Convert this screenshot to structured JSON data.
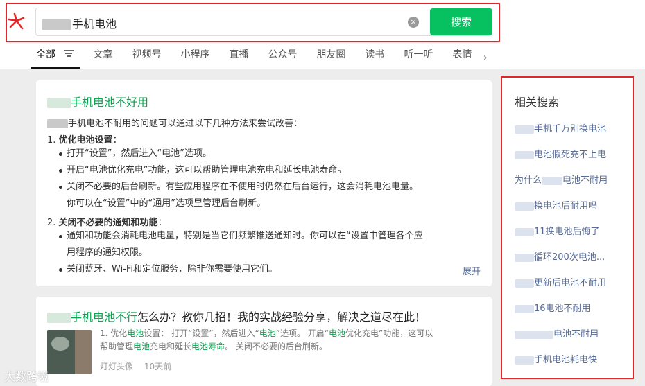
{
  "search": {
    "query_suffix": "手机电池",
    "button_label": "搜索",
    "clear_glyph": "×"
  },
  "tabs": [
    {
      "label": "全部"
    },
    {
      "label": "文章"
    },
    {
      "label": "视频号"
    },
    {
      "label": "小程序"
    },
    {
      "label": "直播"
    },
    {
      "label": "公众号"
    },
    {
      "label": "朋友圈"
    },
    {
      "label": "读书"
    },
    {
      "label": "听一听"
    },
    {
      "label": "表情"
    }
  ],
  "tabs_more_glyph": "›",
  "result1": {
    "title_suffix": "手机电池不好用",
    "intro_suffix": "手机电池不耐用的问题可以通过以下几种方法来尝试改善：",
    "sec1_num": "1.",
    "sec1_head": "优化电池设置",
    "sec1_colon": "：",
    "sec1_b1": "打开“设置”，然后进入“电池”选项。",
    "sec1_b2": "开启“电池优化充电”功能，这可以帮助管理电池充电和延长电池寿命。",
    "sec1_b3a": "关闭不必要的后台刷新。有些应用程序在不使用时仍然在后台运行，这会消耗电池电量。",
    "sec1_b3b": "你可以在“设置”中的“通用”选项里管理后台刷新。",
    "sec2_num": "2.",
    "sec2_head": "关闭不必要的通知和功能",
    "sec2_colon": "：",
    "sec2_b1a": "通知和功能会消耗电池电量，特别是当它们频繁推送通知时。你可以在“设置中管理各个应",
    "sec2_b1b": "用程序的通知权限。",
    "sec2_b2": "关闭蓝牙、Wi-Fi和定位服务，除非你需要使用它们。",
    "expand_label": "展开"
  },
  "result2": {
    "title_em": "手机电池不行",
    "title_rest": "怎么办？教你几招！我的实战经验分享，解决之道尽在此！",
    "snip1": "1. 优化",
    "snip_hl1": "电池",
    "snip2": "设置： 打开“设置”，然后进入“",
    "snip_hl2": "电池",
    "snip3": "”选项。 开启“",
    "snip_hl3": "电池",
    "snip4": "优化充电”功能，这可以",
    "snip5": "帮助管理",
    "snip_hl4": "电池",
    "snip6": "充电和延长",
    "snip_hl5": "电池寿命",
    "snip7": "。 关闭不必要的后台刷新。",
    "author": "灯灯头像",
    "time": "10天前"
  },
  "related": {
    "title": "相关搜索",
    "items": [
      "手机千万别换电池",
      "电池假死充不上电",
      "为什么",
      "电池不耐用",
      "换电池后耐用吗",
      "11换电池后悔了",
      "循环200次电池...",
      "更新后电池不耐用",
      "16电池不耐用",
      "电池不耐用",
      "手机电池耗电快"
    ]
  },
  "watermark": "大数跨境",
  "colors": {
    "accent": "#07c160",
    "link_green": "#07a34f",
    "link_blue": "#576b95",
    "highlight_box": "#e3262a"
  }
}
